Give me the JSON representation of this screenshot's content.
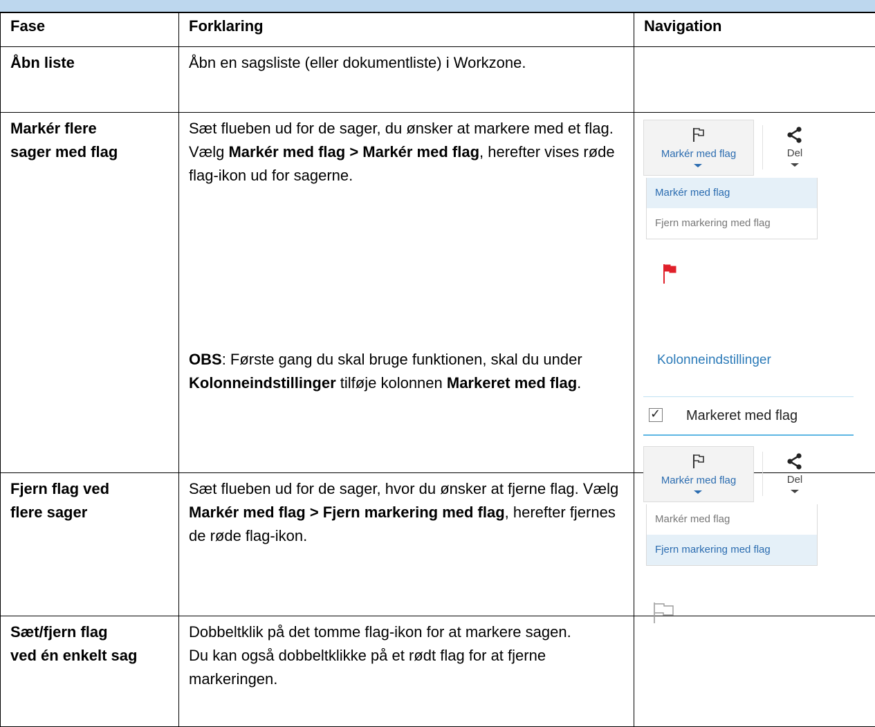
{
  "table": {
    "headers": [
      "Fase",
      "Forklaring",
      "Navigation"
    ],
    "rows": [
      {
        "fase": "Åbn liste",
        "text": "Åbn en sagsliste (eller dokumentliste) i Workzone."
      },
      {
        "fase_line1": "Markér flere",
        "fase_line2": "sager med flag",
        "p1": "Sæt flueben ud for de sager, du ønsker at markere med et flag. Vælg ",
        "p1_b1": "Markér med flag > Markér med flag",
        "p1_end": ", herefter vises røde flag-ikon ud for sagerne.",
        "obs": "OBS",
        "obs_1": ": Første gang du skal bruge funktionen, skal du under ",
        "obs_b1": "Kolonneindstillinger",
        "obs_2": " tilføje kolonnen ",
        "obs_b2": "Markeret med flag",
        "obs_3": "."
      },
      {
        "fase_line1": "Fjern flag ved",
        "fase_line2": "flere sager",
        "p1": "Sæt flueben ud for de sager, hvor du ønsker at fjerne flag. Vælg ",
        "p1_b1": "Markér med flag > Fjern markering med flag",
        "p1_end": ", herefter fjernes de røde flag-ikon."
      },
      {
        "fase_line1": "Sæt/fjern flag",
        "fase_line2": "ved én enkelt sag",
        "line1": "Dobbeltklik på det tomme flag-ikon for at markere sagen.",
        "line2": "Du kan også dobbeltklikke på et rødt flag for at fjerne markeringen."
      }
    ]
  },
  "ui": {
    "flag_button_label": "Markér med flag",
    "share_button_label": "Del",
    "menu_mark": "Markér med flag",
    "menu_remove": "Fjern markering med flag",
    "column_settings_link": "Kolonneindstillinger",
    "column_checkbox_label": "Markeret med flag",
    "checkmark": "✓"
  },
  "icons": {
    "flag": "flag-outline-icon",
    "share": "share-icon",
    "red_flag": "red-flag-icon",
    "empty_flag": "empty-flag-icon"
  },
  "colors": {
    "header_band": "#bdd7ee",
    "link_blue": "#2b7ab8",
    "flag_red": "#e0202a",
    "menu_highlight": "#e5f0f8"
  }
}
